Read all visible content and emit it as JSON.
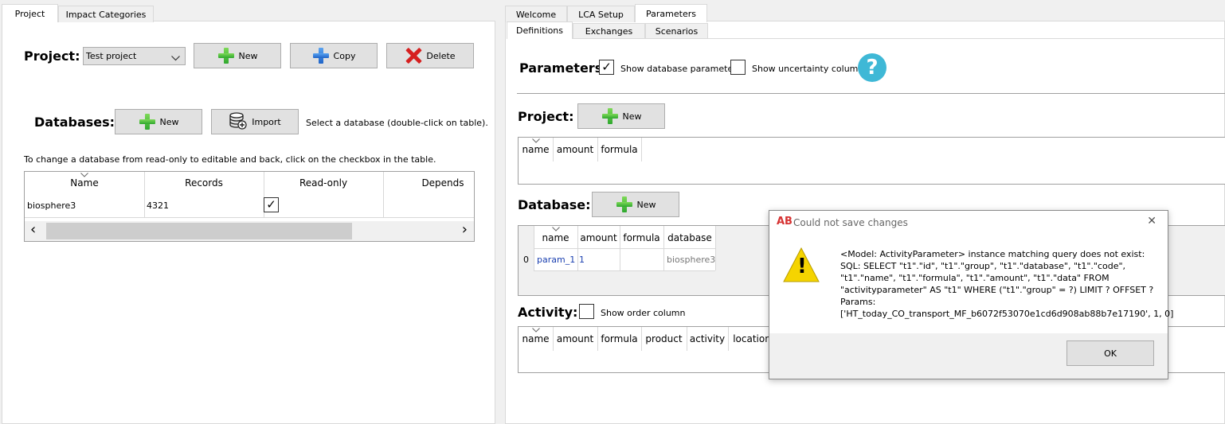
{
  "left_tabs": [
    "Project",
    "Impact Categories"
  ],
  "right_tabs": [
    "Welcome",
    "LCA Setup",
    "Parameters"
  ],
  "param_subtabs": [
    "Definitions",
    "Exchanges",
    "Scenarios"
  ],
  "project_panel": {
    "project_label": "Project:",
    "project_select_value": "Test project",
    "new_label": "New",
    "copy_label": "Copy",
    "delete_label": "Delete",
    "databases_label": "Databases:",
    "db_new_label": "New",
    "import_label": "Import",
    "select_hint": "Select a database (double-click on table).",
    "readonly_hint": "To change a database from read-only to editable and back, click on the checkbox in the table.",
    "table": {
      "headers": [
        "Name",
        "Records",
        "Read-only",
        "Depends"
      ],
      "rows": [
        [
          "biosphere3",
          "4321",
          "✓",
          ""
        ]
      ]
    },
    "scroll_left": "‹",
    "scroll_right": "›"
  },
  "parameters": {
    "title": "Parameters",
    "show_db_params": "Show database parameters",
    "show_db_params_checked": "✓",
    "show_uncertainty": "Show uncertainty columns",
    "help_glyph": "?",
    "project_label": "Project:",
    "project_new": "New",
    "project_headers": [
      "name",
      "amount",
      "formula"
    ],
    "database_label": "Database:",
    "database_new": "New",
    "database_headers": [
      "name",
      "amount",
      "formula",
      "database"
    ],
    "database_rows": [
      [
        "0",
        "param_1",
        "1",
        "",
        "biosphere3"
      ]
    ],
    "activity_label": "Activity:",
    "show_order": "Show order column",
    "activity_headers": [
      "name",
      "amount",
      "formula",
      "product",
      "activity",
      "location"
    ]
  },
  "dialog": {
    "app_icon": "AB",
    "title": "Could not save changes",
    "close_glyph": "✕",
    "warning_glyph": "!",
    "message": "<Model: ActivityParameter> instance matching query does not exist:\nSQL: SELECT \"t1\".\"id\", \"t1\".\"group\", \"t1\".\"database\", \"t1\".\"code\",\n\"t1\".\"name\", \"t1\".\"formula\", \"t1\".\"amount\", \"t1\".\"data\" FROM\n\"activityparameter\" AS \"t1\" WHERE (\"t1\".\"group\" = ?) LIMIT ? OFFSET ?\nParams:\n['HT_today_CO_transport_MF_b6072f53070e1cd6d908ab88b7e17190', 1, 0]",
    "ok_label": "OK"
  },
  "colors": {
    "accent_blue": "#3fb8d6",
    "link_blue": "#1a3fb0",
    "warning_yellow": "#f5d400"
  }
}
